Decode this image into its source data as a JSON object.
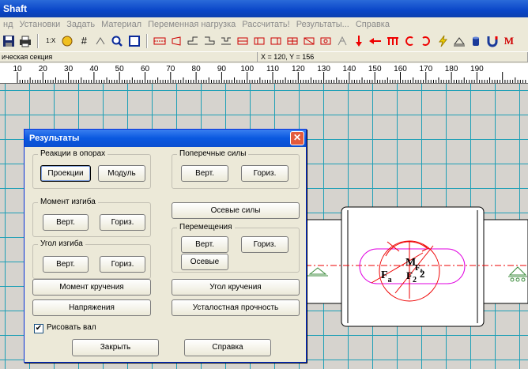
{
  "window": {
    "title": "Shaft"
  },
  "menu": [
    "нд",
    "Установки",
    "Задать",
    "Материал",
    "Переменная нагрузка",
    "Рассчитать!",
    "Результаты...",
    "Справка"
  ],
  "toolbar": {
    "zoom_label": "1:X",
    "bold_m_label": "M"
  },
  "status": {
    "section": "ическая секция",
    "coords": "X = 120, Y = 156"
  },
  "ruler": {
    "ticks": [
      "10",
      "20",
      "30",
      "40",
      "50",
      "60",
      "70",
      "80",
      "90",
      "100",
      "110",
      "120",
      "130",
      "140",
      "150",
      "160",
      "170",
      "180",
      "190"
    ]
  },
  "shaft": {
    "labels": {
      "fa": "F",
      "fa_sub": "a",
      "m": "M",
      "f2": "F",
      "f2_sub": "2",
      "f2b": "2",
      "ft": "F",
      "ft_sub": "t"
    }
  },
  "dialog": {
    "title": "Результаты",
    "close_glyph": "✕",
    "groups": {
      "reactions": {
        "legend": "Реакции в опорах",
        "buttons": [
          "Проекции",
          "Модуль"
        ]
      },
      "bending_moment": {
        "legend": "Момент изгиба",
        "buttons": [
          "Верт.",
          "Гориз."
        ]
      },
      "bending_angle": {
        "legend": "Угол изгиба",
        "buttons": [
          "Верт.",
          "Гориз."
        ]
      },
      "shear_forces": {
        "legend": "Поперечные силы",
        "buttons": [
          "Верт.",
          "Гориз."
        ]
      },
      "displacements": {
        "legend": "Перемещения",
        "buttons": [
          "Верт.",
          "Гориз.",
          "Осевые"
        ]
      }
    },
    "axial_forces": "Осевые силы",
    "torque": "Момент кручения",
    "twist_angle": "Угол кручения",
    "stresses": "Напряжения",
    "fatigue": "Усталостная прочность",
    "draw_shaft": {
      "label": "Рисовать вал",
      "checked": true,
      "mark": "✔"
    },
    "close": "Закрыть",
    "help": "Справка"
  }
}
